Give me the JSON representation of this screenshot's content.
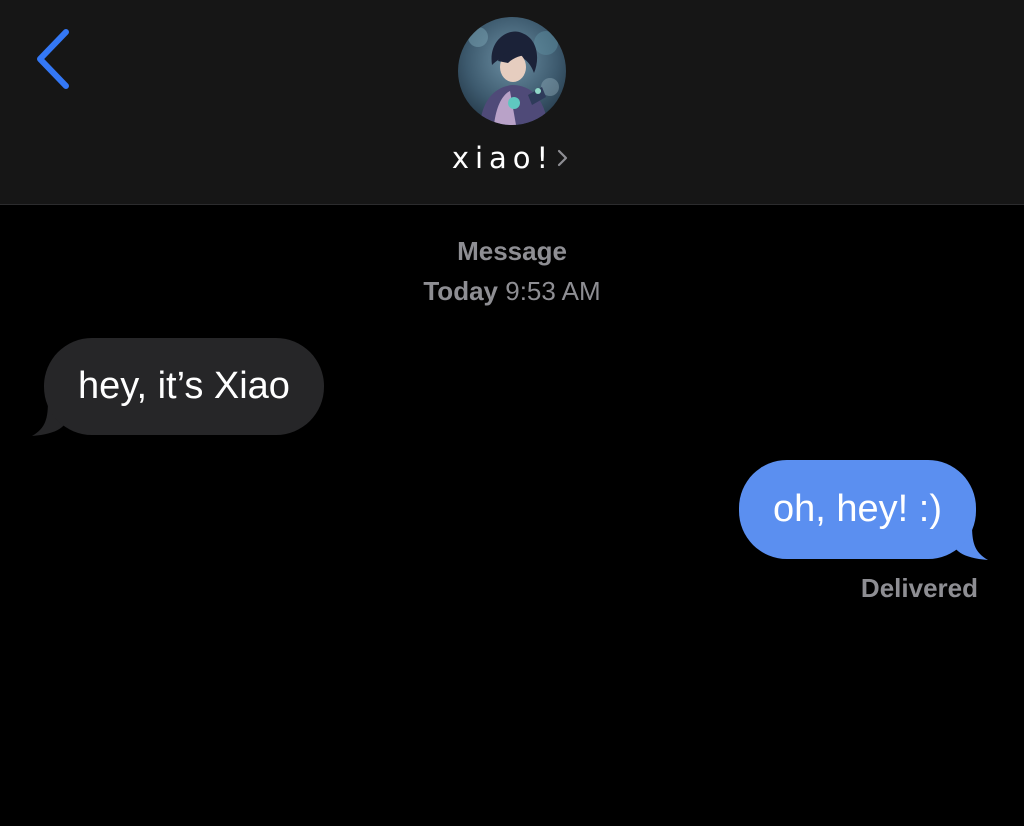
{
  "header": {
    "back_icon": "chevron-left-icon",
    "contact_name": "xiao!",
    "name_chevron_icon": "chevron-right-icon",
    "avatar_icon": "contact-avatar"
  },
  "thread": {
    "service_label": "Message",
    "day_label": "Today",
    "time_label": "9:53 AM"
  },
  "messages": [
    {
      "direction": "incoming",
      "text": "hey, it’s Xiao"
    },
    {
      "direction": "outgoing",
      "text": "oh, hey! :)"
    }
  ],
  "status": {
    "delivered_label": "Delivered"
  },
  "colors": {
    "background": "#000000",
    "header_background": "#161616",
    "incoming_bubble": "#262628",
    "outgoing_bubble": "#5b8ff0",
    "accent_blue": "#3478f6",
    "meta_gray": "#8e8e93"
  }
}
